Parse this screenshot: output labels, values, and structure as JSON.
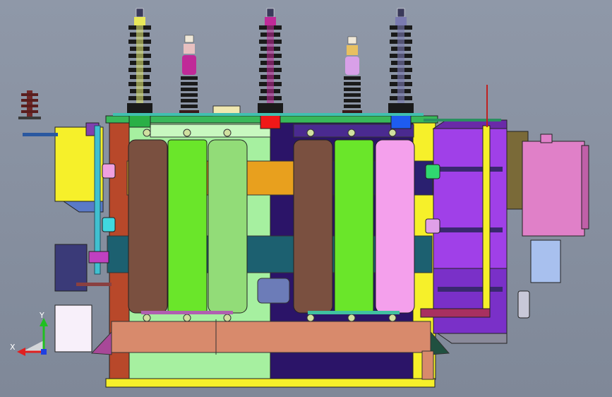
{
  "triad": {
    "x_label": "X",
    "y_label": "Y"
  },
  "colors": {
    "background": "#8a93a3",
    "tank_light_green": "#a6f0a0",
    "tank_dark_purple": "#2b1468",
    "tank_rust": "#b8482a",
    "winding_brown": "#7a5040",
    "winding_green": "#6ae62a",
    "winding_light_green": "#92dc78",
    "winding_pink": "#f4a0ec",
    "core_yokes_orange": "#e8a01e",
    "core_teal": "#1c6070",
    "base_beam_salmon": "#d88a6c",
    "conservator_yellow": "#f6f02a",
    "cooler_violet": "#a040e8",
    "control_box_pink": "#e080c8",
    "gauge_box_blue": "#a8c0ee",
    "bushing_black": "#1a1a1a",
    "bushing_magenta": "#c02a98",
    "bushing_cap_yellow": "#e8e85a",
    "terminal_box_red": "#f01818",
    "terminal_box_blue": "#1e5cf0",
    "terminal_box_green": "#2ab046"
  }
}
